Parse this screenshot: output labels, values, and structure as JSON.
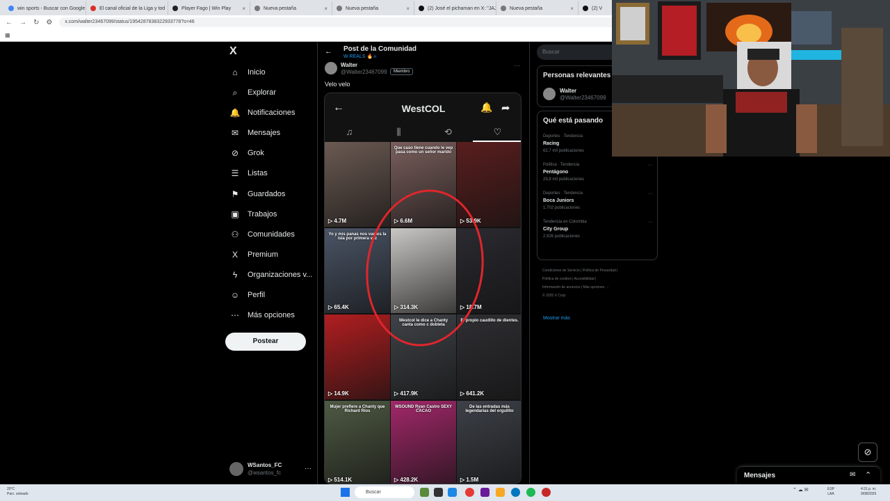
{
  "browser": {
    "tabs": [
      {
        "label": "win sports - Buscar con Google",
        "color": "#4285f4"
      },
      {
        "label": "El canal oficial de la Liga y tod",
        "color": "#d93025"
      },
      {
        "label": "Player Fago | Win Play",
        "color": "#222222"
      },
      {
        "label": "Nueva pestaña",
        "color": "#777777"
      },
      {
        "label": "Nueva pestaña",
        "color": "#777777"
      },
      {
        "label": "(2) José el pichaman en X: \"JAJ",
        "color": "#111111"
      },
      {
        "label": "Nueva pestaña",
        "color": "#777777"
      },
      {
        "label": "(2) V",
        "color": "#111111"
      }
    ],
    "url": "x.com/walter23467099/status/1954287838322933778?s=46"
  },
  "nav": {
    "logo": "X",
    "items": [
      {
        "label": "Inicio",
        "icon": "⌂",
        "name": "home-icon"
      },
      {
        "label": "Explorar",
        "icon": "⌕",
        "name": "search-icon"
      },
      {
        "label": "Notificaciones",
        "icon": "🔔",
        "name": "bell-icon"
      },
      {
        "label": "Mensajes",
        "icon": "✉",
        "name": "mail-icon"
      },
      {
        "label": "Grok",
        "icon": "⊘",
        "name": "grok-icon"
      },
      {
        "label": "Listas",
        "icon": "☰",
        "name": "list-icon"
      },
      {
        "label": "Guardados",
        "icon": "⚑",
        "name": "bookmark-icon"
      },
      {
        "label": "Trabajos",
        "icon": "▣",
        "name": "briefcase-icon"
      },
      {
        "label": "Comunidades",
        "icon": "⚇",
        "name": "communities-icon"
      },
      {
        "label": "Premium",
        "icon": "X",
        "name": "premium-icon"
      },
      {
        "label": "Organizaciones v...",
        "icon": "ϟ",
        "name": "lightning-icon"
      },
      {
        "label": "Perfil",
        "icon": "☺",
        "name": "profile-icon"
      },
      {
        "label": "Más opciones",
        "icon": "⋯",
        "name": "more-icon"
      }
    ],
    "post_label": "Postear",
    "user": {
      "name": "WSantos_FC",
      "handle": "@wsantos_fc"
    }
  },
  "post": {
    "header_title": "Post de la Comunidad",
    "community": "W REALS 🔥⚔",
    "author_name": "Walter",
    "author_handle": "@Walter23467099",
    "badge": "Miembro",
    "text": "Velo velo",
    "embed": {
      "profile_name": "WestCOL",
      "tabs": [
        "♫",
        "⫼",
        "⟲",
        "♡"
      ],
      "active_tab": 3,
      "videos": [
        {
          "caption": "",
          "views": "4.7M",
          "bg": "#6b5a52"
        },
        {
          "caption": "Que caso tiene cuando le vep pasa como un señor marido",
          "views": "6.6M",
          "bg": "#7a5f5c"
        },
        {
          "caption": "",
          "views": "53.9K",
          "bg": "#5a1e1e"
        },
        {
          "caption": "Yo y mis panas nos vamos la isla por primera vez",
          "views": "65.4K",
          "bg": "#4b5566"
        },
        {
          "caption": "",
          "views": "314.3K",
          "bg": "#c9c7c4"
        },
        {
          "caption": "",
          "views": "18.7M",
          "bg": "#2a2a30"
        },
        {
          "caption": "",
          "views": "14.9K",
          "bg": "#b11e20"
        },
        {
          "caption": "Westcol le dice a Chanty canta como c dobleta",
          "views": "417.9K",
          "bg": "#3f4247"
        },
        {
          "caption": "El propio caudillo de dientes.",
          "views": "641.2K",
          "bg": "#2f2f33"
        },
        {
          "caption": "Mujer prefiere a Chanty que Richard Ríos",
          "views": "514.1K",
          "bg": "#4f5a43"
        },
        {
          "caption": "WSOUND Ryan Castro SEXY CACAO",
          "views": "428.2K",
          "bg": "#a3286a"
        },
        {
          "caption": "De las entradas más legendarias del orgullito",
          "views": "1.5M",
          "bg": "#3d4148"
        }
      ]
    }
  },
  "right": {
    "search_placeholder": "Buscar",
    "relevant_title": "Personas relevantes",
    "relevant_user": {
      "name": "Walter",
      "handle": "@Walter23467099"
    },
    "trends_title": "Qué está pasando",
    "trends": [
      {
        "context": "Deportes · Tendencia",
        "title": "Racing",
        "posts": "62,7 mil publicaciones"
      },
      {
        "context": "Política · Tendencia",
        "title": "Pentágono",
        "posts": "29,8 mil publicaciones"
      },
      {
        "context": "Deportes · Tendencia",
        "title": "Boca Juniors",
        "posts": "1.702 publicaciones"
      },
      {
        "context": "Tendencia en Colombia",
        "title": "City Group",
        "posts": "2.926 publicaciones"
      }
    ],
    "show_more": "Mostrar más",
    "footer": [
      "Condiciones de Servicio | Política de Privacidad |",
      "Política de cookies | Accesibilidad |",
      "Información de anuncios | Más opciones ···",
      "© 2025 X Corp."
    ]
  },
  "messages_label": "Mensajes",
  "taskbar": {
    "weather_temp": "20°C",
    "weather_desc": "Parc. soleado",
    "search": "Buscar",
    "lang1": "ESP",
    "lang2": "LAA",
    "time": "4:31 p. m.",
    "date": "9/08/2025"
  }
}
